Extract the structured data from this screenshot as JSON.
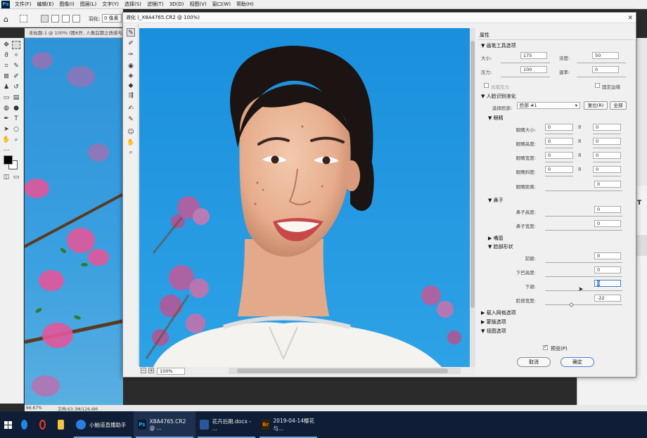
{
  "menubar": {
    "items": [
      "文件(F)",
      "编辑(E)",
      "图像(I)",
      "图层(L)",
      "文字(Y)",
      "选择(S)",
      "滤镜(T)",
      "3D(D)",
      "视图(V)",
      "窗口(W)",
      "帮助(H)"
    ]
  },
  "options": {
    "feather_label": "羽化:",
    "feather_value": "0 像素"
  },
  "doc_tab": "未标题-1 @ 100% (图6开, 人像后期之质感与...",
  "status": {
    "zoom": "66.67%",
    "doc_size": "文档:63.3M/126.6M"
  },
  "taskbar": {
    "items": [
      {
        "label": "小脑道直播助手",
        "color": "#2a7de1"
      },
      {
        "label": "X8A4765.CR2 @ ...",
        "color": "#001e36"
      },
      {
        "label": "花卉后期.docx - ...",
        "color": "#2b579a"
      },
      {
        "label": "2019-04-14樱花与...",
        "color": "#e08a00"
      }
    ]
  },
  "liquify": {
    "title": "液化 (_X8A4765.CR2 @ 100%)",
    "zoom": "100%",
    "panel_title": "属性",
    "brush_section": "画笔工具选项",
    "brush": {
      "size_label": "大小:",
      "size": "175",
      "density_label": "浓度:",
      "density": "50",
      "pressure_label": "压力:",
      "pressure": "100",
      "rate_label": "速率:",
      "rate": "0",
      "stylus_label": "光笔压力",
      "pin_label": "固定边缘"
    },
    "face_section": "人脸识别液化",
    "select_face_label": "选择脸部:",
    "select_face_value": "脸部 #1",
    "reset_button": "复位(R)",
    "all_button": "全部",
    "eyes_section": "眼睛",
    "eyes": [
      {
        "label": "眼睛大小:",
        "left": "0",
        "right": "0"
      },
      {
        "label": "眼睛高度:",
        "left": "0",
        "right": "0"
      },
      {
        "label": "眼睛宽度:",
        "left": "0",
        "right": "0"
      },
      {
        "label": "眼睛斜度:",
        "left": "0",
        "right": "0"
      }
    ],
    "eye_distance_label": "眼睛距离:",
    "eye_distance": "0",
    "nose_section": "鼻子",
    "nose": [
      {
        "label": "鼻子高度:",
        "value": "0"
      },
      {
        "label": "鼻子宽度:",
        "value": "0"
      }
    ],
    "mouth_section": "嘴唇",
    "face_shape_section": "脸部形状",
    "face_shape": [
      {
        "label": "前额:",
        "value": "0"
      },
      {
        "label": "下巴高度:",
        "value": "0"
      },
      {
        "label": "下颌:",
        "value": "0"
      },
      {
        "label": "脸部宽度:",
        "value": "-22"
      }
    ],
    "load_mesh_section": "载入网格选项",
    "mask_section": "蒙版选项",
    "view_section": "视图选项",
    "preview_label": "预览(P)",
    "cancel": "取消",
    "ok": "确定"
  }
}
